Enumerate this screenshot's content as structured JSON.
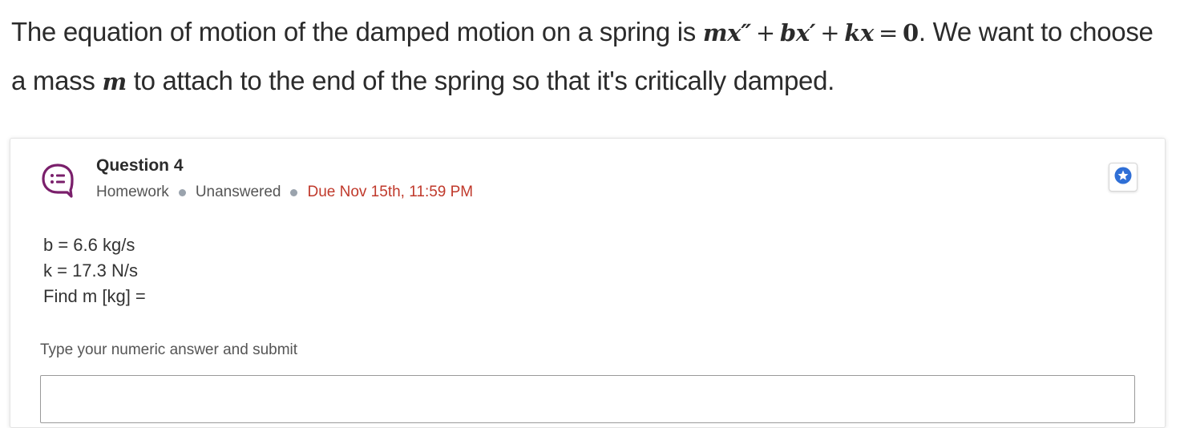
{
  "intro": {
    "text_before": "The equation of motion of the damped motion on a spring is ",
    "eq_m": "mx″",
    "eq_plus1": "+",
    "eq_b": "bx′",
    "eq_plus2": "+",
    "eq_k": "kx",
    "eq_equals": "=",
    "eq_zero": "0",
    "text_after": ". We want to choose a mass ",
    "mass_symbol": "m",
    "text_end": " to attach to the end of the spring so that it's critically damped."
  },
  "question": {
    "title": "Question 4",
    "type": "Homework",
    "status": "Unanswered",
    "due": "Due Nov 15th, 11:59 PM",
    "icon": "question-list-icon",
    "given": [
      "b = 6.6 kg/s",
      "k = 17.3 N/s",
      "Find m [kg] ="
    ],
    "answer_prompt": "Type your numeric answer and submit",
    "answer_value": ""
  },
  "star_icon": "star-badge-icon",
  "colors": {
    "icon_purple": "#7a1f6b",
    "star_blue": "#2f6fd6",
    "due_red": "#c0392b"
  }
}
